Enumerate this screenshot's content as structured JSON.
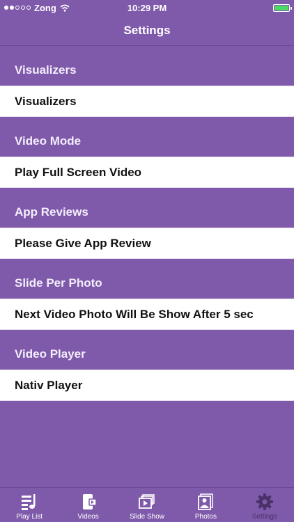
{
  "status": {
    "carrier": "Zong",
    "time": "10:29 PM"
  },
  "nav": {
    "title": "Settings"
  },
  "sections": [
    {
      "header": "Visualizers",
      "row": "Visualizers"
    },
    {
      "header": "Video Mode",
      "row": "Play Full Screen Video"
    },
    {
      "header": "App Reviews",
      "row": "Please Give App Review"
    },
    {
      "header": "Slide Per Photo",
      "row": "Next Video Photo Will Be Show After  5 sec"
    },
    {
      "header": "Video Player",
      "row": "Nativ Player"
    }
  ],
  "tabs": [
    {
      "label": "Play List",
      "icon": "playlist-icon"
    },
    {
      "label": "Videos",
      "icon": "videos-icon"
    },
    {
      "label": "Slide Show",
      "icon": "slideshow-icon"
    },
    {
      "label": "Photos",
      "icon": "photos-icon"
    },
    {
      "label": "Settings",
      "icon": "gear-icon",
      "active": true
    }
  ],
  "colors": {
    "background": "#7f5aab",
    "row": "#ffffff",
    "active_tab": "#4a3168",
    "battery": "#4cd964"
  }
}
